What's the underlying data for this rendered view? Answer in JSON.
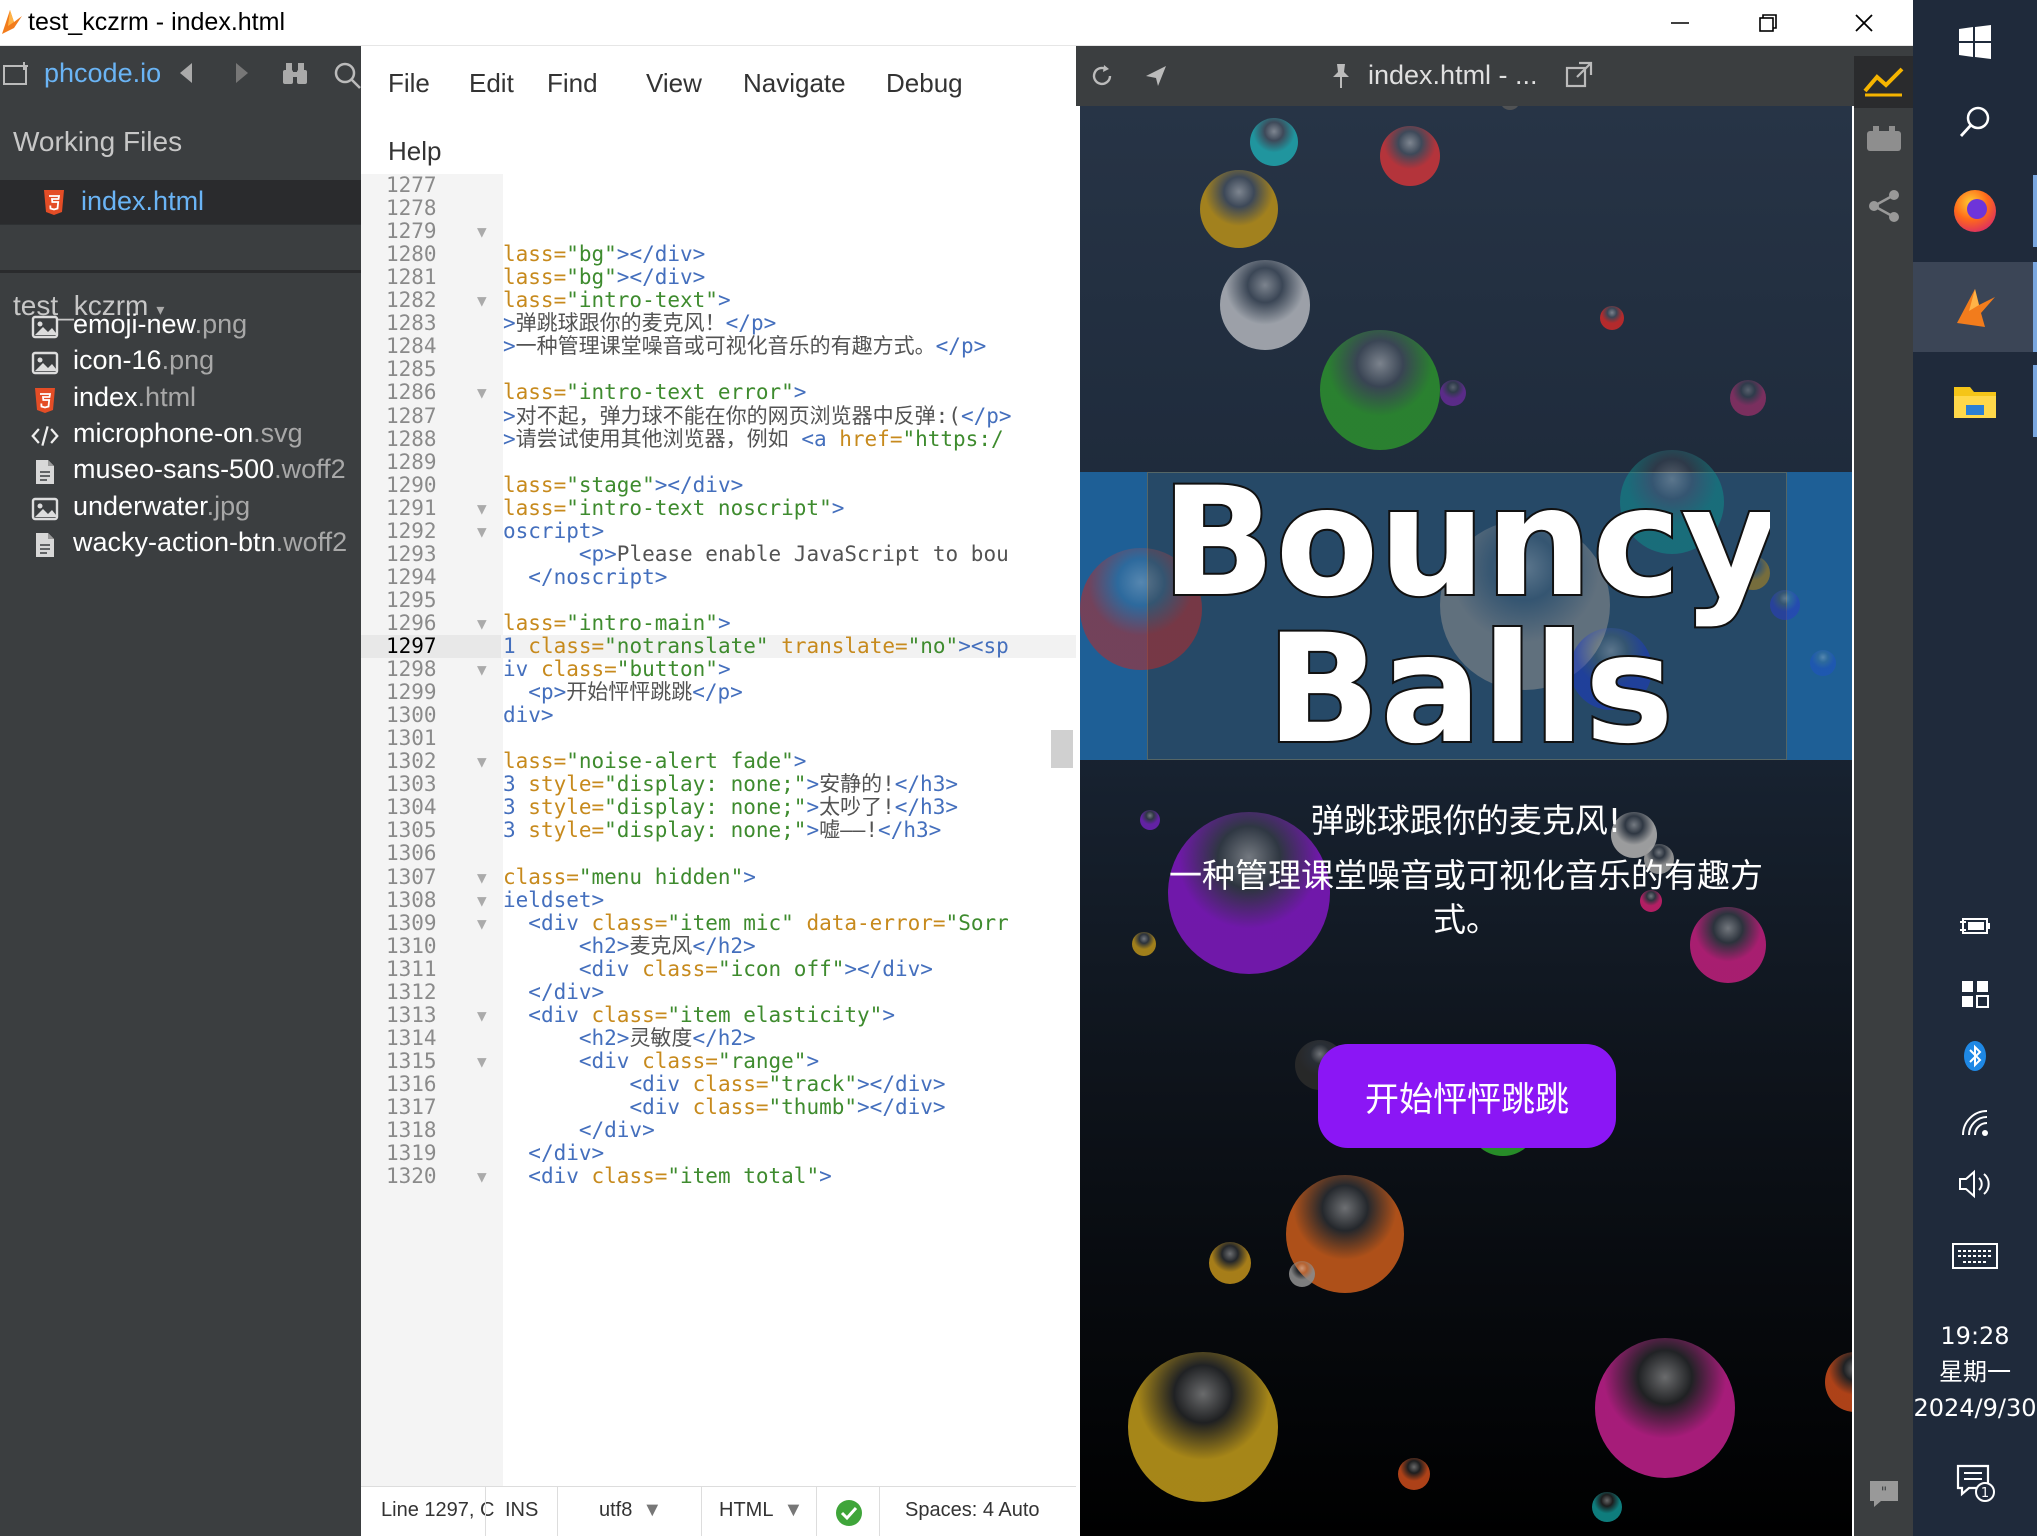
{
  "window": {
    "title": "test_kczrm - index.html"
  },
  "sidebar": {
    "project_link": "phcode.io",
    "working_files_title": "Working Files",
    "working_file": "index.html",
    "project_name": "test_kczrm",
    "files": [
      {
        "base": "emoji-new",
        "ext": ".png",
        "icon": "image-file-icon"
      },
      {
        "base": "icon-16",
        "ext": ".png",
        "icon": "image-file-icon"
      },
      {
        "base": "index",
        "ext": ".html",
        "icon": "html5-file-icon"
      },
      {
        "base": "microphone-on",
        "ext": ".svg",
        "icon": "code-file-icon"
      },
      {
        "base": "museo-sans-500",
        "ext": ".woff2",
        "icon": "generic-file-icon"
      },
      {
        "base": "underwater",
        "ext": ".jpg",
        "icon": "image-file-icon"
      },
      {
        "base": "wacky-action-btn",
        "ext": ".woff2",
        "icon": "generic-file-icon"
      }
    ]
  },
  "menu": {
    "items": [
      "File",
      "Edit",
      "Find",
      "View",
      "Navigate",
      "Debug",
      "Help"
    ]
  },
  "editor": {
    "current_line": 1297,
    "lines": [
      {
        "n": 1277,
        "fold": false,
        "tokens": []
      },
      {
        "n": 1278,
        "fold": false,
        "tokens": []
      },
      {
        "n": 1279,
        "fold": true,
        "tokens": []
      },
      {
        "n": 1280,
        "fold": false,
        "tokens": [
          [
            "attr",
            "lass="
          ],
          [
            "str",
            "\"bg\""
          ],
          [
            "tag",
            "></div>"
          ]
        ]
      },
      {
        "n": 1281,
        "fold": false,
        "tokens": [
          [
            "attr",
            "lass="
          ],
          [
            "str",
            "\"bg\""
          ],
          [
            "tag",
            "></div>"
          ]
        ]
      },
      {
        "n": 1282,
        "fold": true,
        "tokens": [
          [
            "attr",
            "lass="
          ],
          [
            "str",
            "\"intro-text\""
          ],
          [
            "tag",
            ">"
          ]
        ]
      },
      {
        "n": 1283,
        "fold": false,
        "tokens": [
          [
            "tag",
            ">"
          ],
          [
            "txt",
            "弹跳球跟你的麦克风！"
          ],
          [
            "tag",
            "</p>"
          ]
        ]
      },
      {
        "n": 1284,
        "fold": false,
        "tokens": [
          [
            "tag",
            ">"
          ],
          [
            "txt",
            "一种管理课堂噪音或可视化音乐的有趣方式。"
          ],
          [
            "tag",
            "</p>"
          ]
        ]
      },
      {
        "n": 1285,
        "fold": false,
        "tokens": []
      },
      {
        "n": 1286,
        "fold": true,
        "tokens": [
          [
            "attr",
            "lass="
          ],
          [
            "str",
            "\"intro-text error\""
          ],
          [
            "tag",
            ">"
          ]
        ]
      },
      {
        "n": 1287,
        "fold": false,
        "tokens": [
          [
            "tag",
            ">"
          ],
          [
            "txt",
            "对不起，弹力球不能在你的网页浏览器中反弹:("
          ],
          [
            "tag",
            "</p>"
          ]
        ]
      },
      {
        "n": 1288,
        "fold": false,
        "tokens": [
          [
            "tag",
            ">"
          ],
          [
            "txt",
            "请尝试使用其他浏览器，例如 "
          ],
          [
            "tag",
            "<a "
          ],
          [
            "attr",
            "href="
          ],
          [
            "str",
            "\"https:/"
          ]
        ]
      },
      {
        "n": 1289,
        "fold": false,
        "tokens": []
      },
      {
        "n": 1290,
        "fold": false,
        "tokens": [
          [
            "attr",
            "lass="
          ],
          [
            "str",
            "\"stage\""
          ],
          [
            "tag",
            "></div>"
          ]
        ]
      },
      {
        "n": 1291,
        "fold": true,
        "tokens": [
          [
            "attr",
            "lass="
          ],
          [
            "str",
            "\"intro-text noscript\""
          ],
          [
            "tag",
            ">"
          ]
        ]
      },
      {
        "n": 1292,
        "fold": true,
        "tokens": [
          [
            "tag",
            "oscript>"
          ]
        ]
      },
      {
        "n": 1293,
        "fold": false,
        "tokens": [
          [
            "txt",
            "      "
          ],
          [
            "tag",
            "<p>"
          ],
          [
            "txt",
            "Please enable JavaScript to bou"
          ]
        ]
      },
      {
        "n": 1294,
        "fold": false,
        "tokens": [
          [
            "txt",
            "  "
          ],
          [
            "tag",
            "</noscript>"
          ]
        ]
      },
      {
        "n": 1295,
        "fold": false,
        "tokens": []
      },
      {
        "n": 1296,
        "fold": true,
        "tokens": [
          [
            "attr",
            "lass="
          ],
          [
            "str",
            "\"intro-main\""
          ],
          [
            "tag",
            ">"
          ]
        ]
      },
      {
        "n": 1297,
        "fold": false,
        "tokens": [
          [
            "tag",
            "1 "
          ],
          [
            "attr",
            "class="
          ],
          [
            "str",
            "\"notranslate\""
          ],
          [
            "txt",
            " "
          ],
          [
            "attr",
            "translate="
          ],
          [
            "str",
            "\"no\""
          ],
          [
            "tag",
            "><sp"
          ]
        ]
      },
      {
        "n": 1298,
        "fold": true,
        "tokens": [
          [
            "tag",
            "iv "
          ],
          [
            "attr",
            "class="
          ],
          [
            "str",
            "\"button\""
          ],
          [
            "tag",
            ">"
          ]
        ]
      },
      {
        "n": 1299,
        "fold": false,
        "tokens": [
          [
            "txt",
            "  "
          ],
          [
            "tag",
            "<p>"
          ],
          [
            "txt",
            "开始怦怦跳跳"
          ],
          [
            "tag",
            "</p>"
          ]
        ]
      },
      {
        "n": 1300,
        "fold": false,
        "tokens": [
          [
            "tag",
            "div>"
          ]
        ]
      },
      {
        "n": 1301,
        "fold": false,
        "tokens": []
      },
      {
        "n": 1302,
        "fold": true,
        "tokens": [
          [
            "attr",
            "lass="
          ],
          [
            "str",
            "\"noise-alert fade\""
          ],
          [
            "tag",
            ">"
          ]
        ]
      },
      {
        "n": 1303,
        "fold": false,
        "tokens": [
          [
            "tag",
            "3 "
          ],
          [
            "attr",
            "style="
          ],
          [
            "str",
            "\"display: none;\""
          ],
          [
            "tag",
            ">"
          ],
          [
            "txt",
            "安静的!"
          ],
          [
            "tag",
            "</h3>"
          ]
        ]
      },
      {
        "n": 1304,
        "fold": false,
        "tokens": [
          [
            "tag",
            "3 "
          ],
          [
            "attr",
            "style="
          ],
          [
            "str",
            "\"display: none;\""
          ],
          [
            "tag",
            ">"
          ],
          [
            "txt",
            "太吵了!"
          ],
          [
            "tag",
            "</h3>"
          ]
        ]
      },
      {
        "n": 1305,
        "fold": false,
        "tokens": [
          [
            "tag",
            "3 "
          ],
          [
            "attr",
            "style="
          ],
          [
            "str",
            "\"display: none;\""
          ],
          [
            "tag",
            ">"
          ],
          [
            "txt",
            "嘘——!"
          ],
          [
            "tag",
            "</h3>"
          ]
        ]
      },
      {
        "n": 1306,
        "fold": false,
        "tokens": []
      },
      {
        "n": 1307,
        "fold": true,
        "tokens": [
          [
            "attr",
            "class="
          ],
          [
            "str",
            "\"menu hidden\""
          ],
          [
            "tag",
            ">"
          ]
        ]
      },
      {
        "n": 1308,
        "fold": true,
        "tokens": [
          [
            "tag",
            "ieldset>"
          ]
        ]
      },
      {
        "n": 1309,
        "fold": true,
        "tokens": [
          [
            "txt",
            "  "
          ],
          [
            "tag",
            "<div "
          ],
          [
            "attr",
            "class="
          ],
          [
            "str",
            "\"item mic\""
          ],
          [
            "txt",
            " "
          ],
          [
            "attr",
            "data-error="
          ],
          [
            "str",
            "\"Sorr"
          ]
        ]
      },
      {
        "n": 1310,
        "fold": false,
        "tokens": [
          [
            "txt",
            "      "
          ],
          [
            "tag",
            "<h2>"
          ],
          [
            "txt",
            "麦克风"
          ],
          [
            "tag",
            "</h2>"
          ]
        ]
      },
      {
        "n": 1311,
        "fold": false,
        "tokens": [
          [
            "txt",
            "      "
          ],
          [
            "tag",
            "<div "
          ],
          [
            "attr",
            "class="
          ],
          [
            "str",
            "\"icon off\""
          ],
          [
            "tag",
            "></div>"
          ]
        ]
      },
      {
        "n": 1312,
        "fold": false,
        "tokens": [
          [
            "txt",
            "  "
          ],
          [
            "tag",
            "</div>"
          ]
        ]
      },
      {
        "n": 1313,
        "fold": true,
        "tokens": [
          [
            "txt",
            "  "
          ],
          [
            "tag",
            "<div "
          ],
          [
            "attr",
            "class="
          ],
          [
            "str",
            "\"item elasticity\""
          ],
          [
            "tag",
            ">"
          ]
        ]
      },
      {
        "n": 1314,
        "fold": false,
        "tokens": [
          [
            "txt",
            "      "
          ],
          [
            "tag",
            "<h2>"
          ],
          [
            "txt",
            "灵敏度"
          ],
          [
            "tag",
            "</h2>"
          ]
        ]
      },
      {
        "n": 1315,
        "fold": true,
        "tokens": [
          [
            "txt",
            "      "
          ],
          [
            "tag",
            "<div "
          ],
          [
            "attr",
            "class="
          ],
          [
            "str",
            "\"range\""
          ],
          [
            "tag",
            ">"
          ]
        ]
      },
      {
        "n": 1316,
        "fold": false,
        "tokens": [
          [
            "txt",
            "          "
          ],
          [
            "tag",
            "<div "
          ],
          [
            "attr",
            "class="
          ],
          [
            "str",
            "\"track\""
          ],
          [
            "tag",
            "></div>"
          ]
        ]
      },
      {
        "n": 1317,
        "fold": false,
        "tokens": [
          [
            "txt",
            "          "
          ],
          [
            "tag",
            "<div "
          ],
          [
            "attr",
            "class="
          ],
          [
            "str",
            "\"thumb\""
          ],
          [
            "tag",
            "></div>"
          ]
        ]
      },
      {
        "n": 1318,
        "fold": false,
        "tokens": [
          [
            "txt",
            "      "
          ],
          [
            "tag",
            "</div>"
          ]
        ]
      },
      {
        "n": 1319,
        "fold": false,
        "tokens": [
          [
            "txt",
            "  "
          ],
          [
            "tag",
            "</div>"
          ]
        ]
      },
      {
        "n": 1320,
        "fold": true,
        "tokens": [
          [
            "txt",
            "  "
          ],
          [
            "tag",
            "<div "
          ],
          [
            "attr",
            "class="
          ],
          [
            "str",
            "\"item total\""
          ],
          [
            "tag",
            ">"
          ]
        ]
      }
    ]
  },
  "statusbar": {
    "position": "Line 1297, C",
    "mode": "INS",
    "encoding": "utf8",
    "language": "HTML",
    "spaces": "Spaces:  4  Auto"
  },
  "preview": {
    "title": "index.html - ...",
    "logo_line1": "Bouncy",
    "logo_line2": "Balls",
    "subtitle1": "弹跳球跟你的麦克风!",
    "subtitle2": "一种管理课堂噪音或可视化音乐的有趣方式。",
    "start_button": "开始怦怦跳跳"
  },
  "taskbar": {
    "time": "19:28",
    "weekday": "星期一",
    "date": "2024/9/30",
    "notification_count": "1"
  },
  "colors": {
    "sidebar_bg": "#3b3e40",
    "link_blue": "#6ab4f5",
    "button_purple": "#8b16f5",
    "taskbar_bg": "#1f2a3b"
  }
}
